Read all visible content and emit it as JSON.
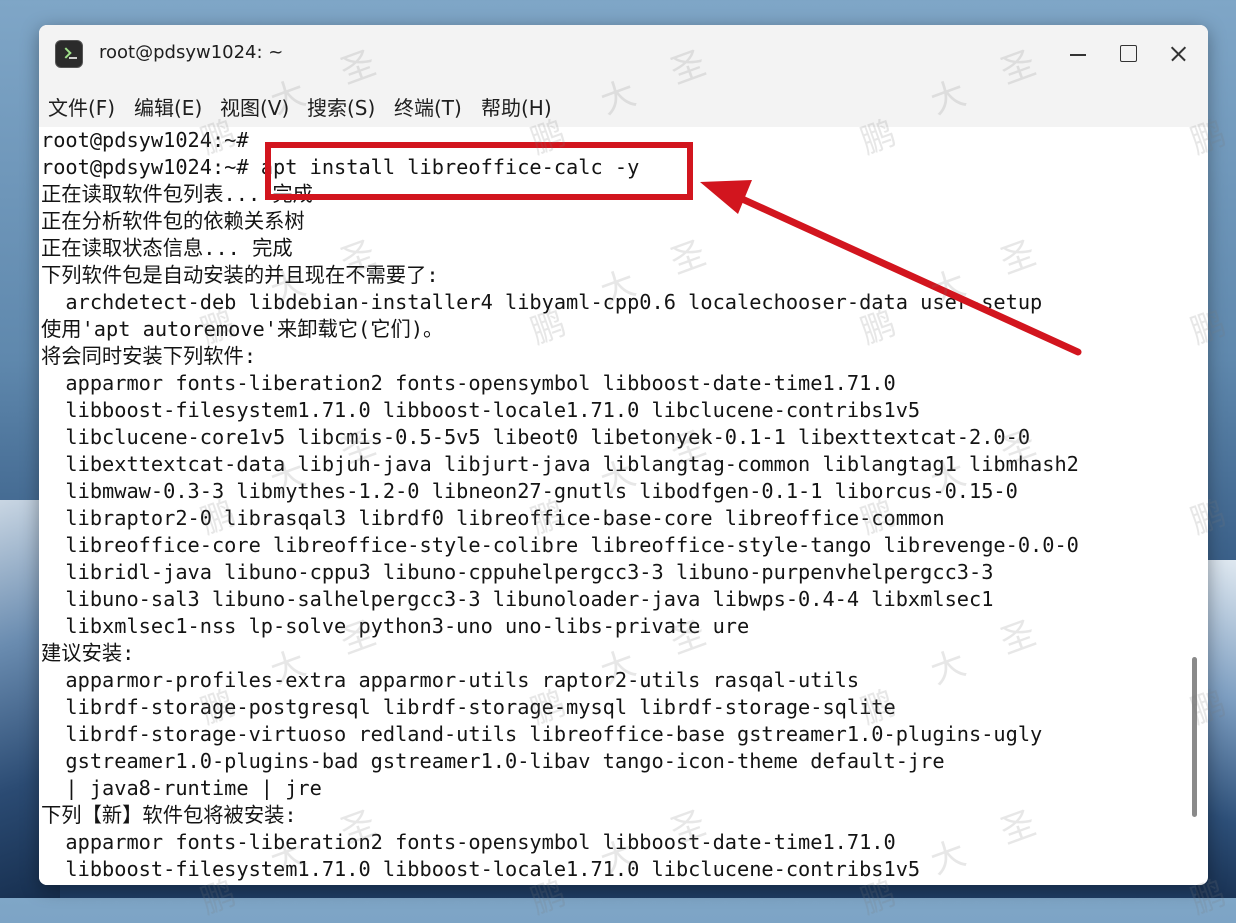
{
  "window": {
    "title": "root@pdsyw1024: ~"
  },
  "menu": [
    {
      "label": "文件(F)"
    },
    {
      "label": "编辑(E)"
    },
    {
      "label": "视图(V)"
    },
    {
      "label": "搜索(S)"
    },
    {
      "label": "终端(T)"
    },
    {
      "label": "帮助(H)"
    }
  ],
  "terminal": {
    "lines": [
      "root@pdsyw1024:~#",
      "root@pdsyw1024:~# apt install libreoffice-calc -y",
      "正在读取软件包列表... 完成",
      "正在分析软件包的依赖关系树",
      "正在读取状态信息... 完成",
      "下列软件包是自动安装的并且现在不需要了:",
      "  archdetect-deb libdebian-installer4 libyaml-cpp0.6 localechooser-data user-setup",
      "使用'apt autoremove'来卸载它(它们)。",
      "将会同时安装下列软件:",
      "  apparmor fonts-liberation2 fonts-opensymbol libboost-date-time1.71.0",
      "  libboost-filesystem1.71.0 libboost-locale1.71.0 libclucene-contribs1v5",
      "  libclucene-core1v5 libcmis-0.5-5v5 libeot0 libetonyek-0.1-1 libexttextcat-2.0-0",
      "  libexttextcat-data libjuh-java libjurt-java liblangtag-common liblangtag1 libmhash2",
      "  libmwaw-0.3-3 libmythes-1.2-0 libneon27-gnutls libodfgen-0.1-1 liborcus-0.15-0",
      "  libraptor2-0 librasqal3 librdf0 libreoffice-base-core libreoffice-common",
      "  libreoffice-core libreoffice-style-colibre libreoffice-style-tango librevenge-0.0-0",
      "  libridl-java libuno-cppu3 libuno-cppuhelpergcc3-3 libuno-purpenvhelpergcc3-3",
      "  libuno-sal3 libuno-salhelpergcc3-3 libunoloader-java libwps-0.4-4 libxmlsec1",
      "  libxmlsec1-nss lp-solve python3-uno uno-libs-private ure",
      "建议安装:",
      "  apparmor-profiles-extra apparmor-utils raptor2-utils rasqal-utils",
      "  librdf-storage-postgresql librdf-storage-mysql librdf-storage-sqlite",
      "  librdf-storage-virtuoso redland-utils libreoffice-base gstreamer1.0-plugins-ugly",
      "  gstreamer1.0-plugins-bad gstreamer1.0-libav tango-icon-theme default-jre",
      "  | java8-runtime | jre",
      "下列【新】软件包将被安装:",
      "  apparmor fonts-liberation2 fonts-opensymbol libboost-date-time1.71.0",
      "  libboost-filesystem1.71.0 libboost-locale1.71.0 libclucene-contribs1v5"
    ]
  },
  "watermarks": [
    "鹏",
    "大",
    "圣"
  ],
  "colors": {
    "highlight": "#d2151e",
    "terminal_bg": "#ffffff",
    "terminal_fg": "#141414"
  }
}
